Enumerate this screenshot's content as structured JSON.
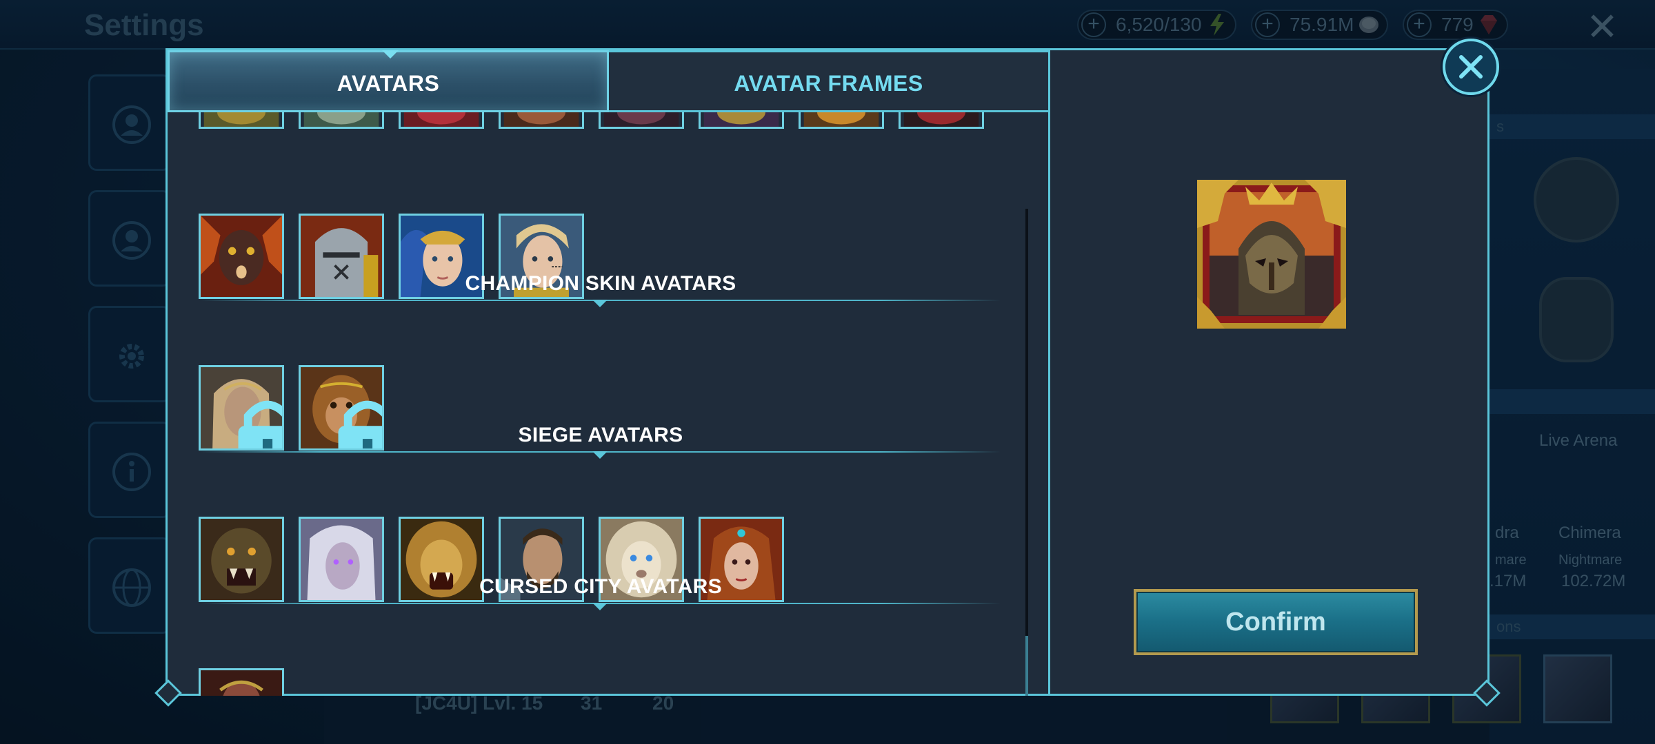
{
  "background": {
    "screen_title": "Settings",
    "resources": [
      {
        "value": "6,520/130",
        "icon": "energy-icon"
      },
      {
        "value": "75.91M",
        "icon": "silver-icon"
      },
      {
        "value": "779",
        "icon": "gem-icon"
      }
    ],
    "clan_info": {
      "tag_level": "[JC4U] Lvl. 15",
      "stat_a": "31",
      "stat_b": "20"
    },
    "right_panel": {
      "live_arena_label": "Live Arena",
      "boss_partial": "dra",
      "boss_chimera": "Chimera",
      "difficulty_partial": "mare",
      "difficulty_chimera": "Nightmare",
      "damage_partial": ".17M",
      "damage_chimera": "102.72M",
      "strip_top_partial": "s",
      "strip_bottom_partial": "ons"
    }
  },
  "tabs": {
    "avatars": "AVATARS",
    "avatar_frames": "AVATAR FRAMES",
    "active": "avatars"
  },
  "sections": {
    "champion_skin": "CHAMPION SKIN AVATARS",
    "siege": "SIEGE AVATARS",
    "cursed_city": "CURSED CITY AVATARS"
  },
  "avatar_rows": {
    "partial_row": [
      "avatar-champion",
      "avatar-champion",
      "avatar-champion",
      "avatar-champion",
      "avatar-champion",
      "avatar-champion",
      "avatar-champion",
      "avatar-champion"
    ],
    "top_row": [
      "demon-avatar",
      "knight-helm-avatar",
      "elf-queen-avatar",
      "blonde-warrior-avatar"
    ],
    "champion_skin": [
      {
        "name": "blonde-skin-avatar",
        "locked": true
      },
      {
        "name": "monkey-skin-avatar",
        "locked": true
      }
    ],
    "siege": [
      "orc-avatar",
      "white-haired-avatar",
      "lion-roar-avatar",
      "bearded-warrior-avatar",
      "white-lion-avatar",
      "red-sorceress-avatar"
    ],
    "cursed_city": [
      "cursed-avatar"
    ]
  },
  "preview": {
    "name": "selected-avatar-preview",
    "frame": "gold-frame"
  },
  "confirm_label": "Confirm",
  "colors": {
    "accent": "#5bc6da",
    "panel": "#1f2c3b",
    "gold": "#b39a4e"
  }
}
